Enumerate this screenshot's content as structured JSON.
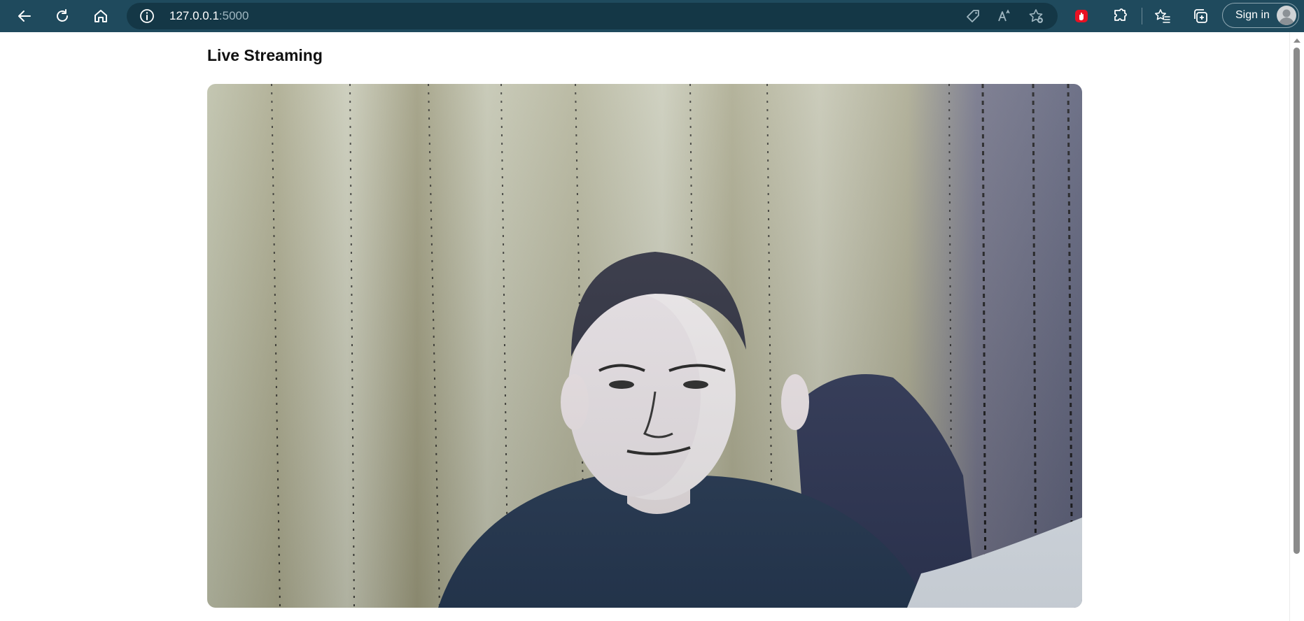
{
  "browser": {
    "url_host": "127.0.0.1",
    "url_port": ":5000",
    "signin_label": "Sign in",
    "icons": [
      "back-icon",
      "refresh-icon",
      "home-icon",
      "info-icon",
      "tag-icon",
      "read-aloud-icon",
      "add-favorite-icon",
      "extension-red-icon",
      "extensions-icon",
      "favorites-icon",
      "collections-icon",
      "profile-avatar-icon"
    ]
  },
  "page": {
    "title": "Live Streaming"
  },
  "colors": {
    "toolbar": "#1f4a5d",
    "address_bar": "#143746",
    "page_bg": "#ffffff"
  }
}
